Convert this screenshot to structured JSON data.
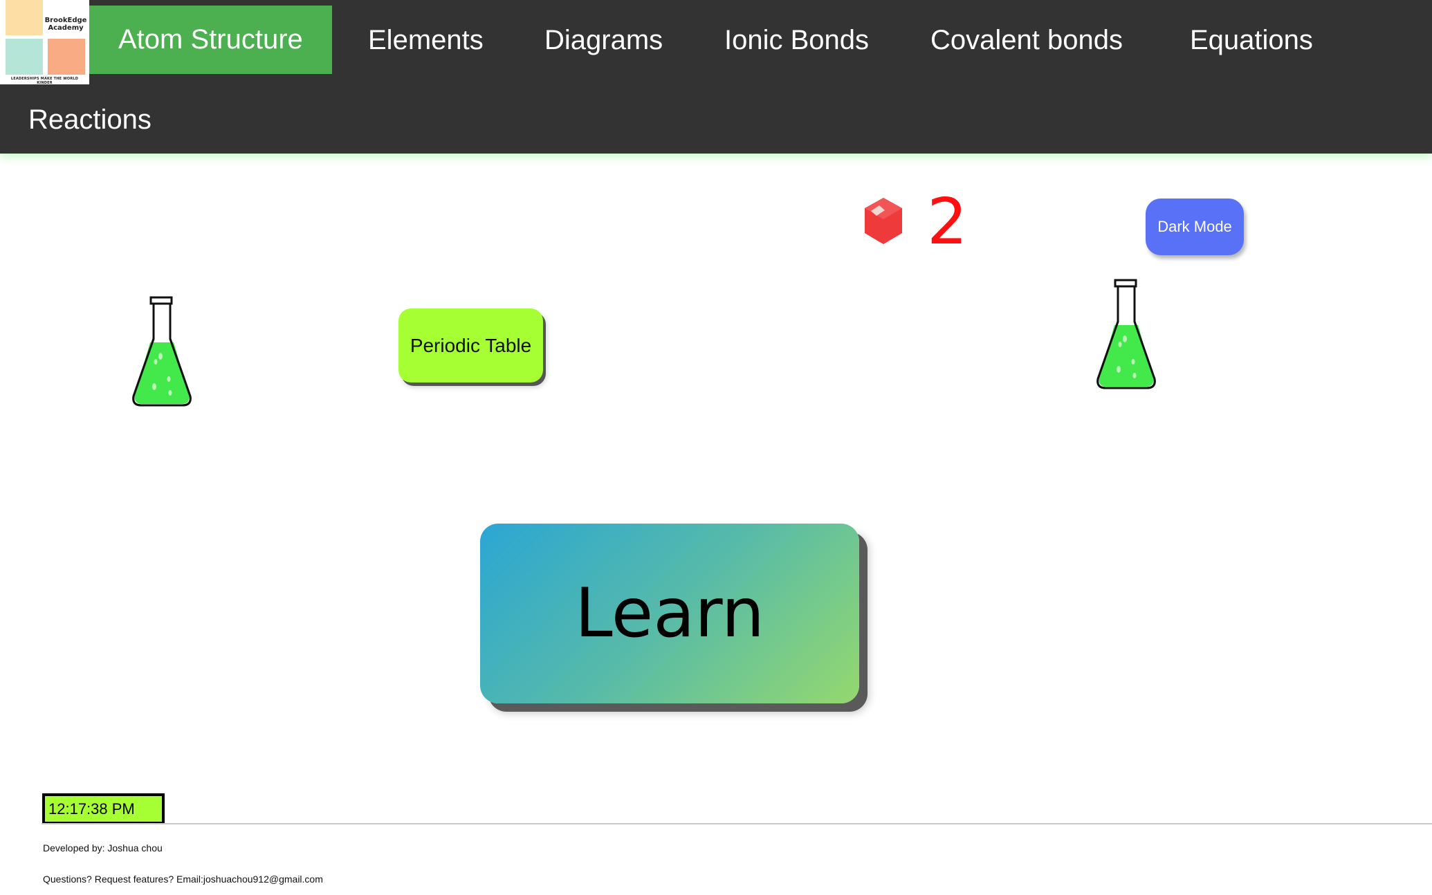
{
  "brand": {
    "name_line1": "BrookEdge",
    "name_line2": "Academy",
    "tagline": "LEADERSHIPS MAKE THE WORLD KINDER"
  },
  "nav": {
    "items": [
      {
        "label": "Atom Structure",
        "active": true
      },
      {
        "label": "Elements"
      },
      {
        "label": "Diagrams"
      },
      {
        "label": "Ionic Bonds"
      },
      {
        "label": "Covalent bonds"
      },
      {
        "label": "Equations"
      },
      {
        "label": "Reactions"
      }
    ]
  },
  "score": {
    "value": "2",
    "icon": "red-gem-icon",
    "color": "#ff1010"
  },
  "buttons": {
    "dark_mode": "Dark Mode",
    "periodic_table": "Periodic Table",
    "learn": "Learn"
  },
  "icons": {
    "flask_left": "flask-icon",
    "flask_right": "flask-icon"
  },
  "colors": {
    "nav_bg": "#333333",
    "nav_active": "#4caf50",
    "lime": "#a6ff33",
    "dark_mode_btn": "#5971f7"
  },
  "clock": {
    "time": "12:17:38 PM"
  },
  "footer": {
    "developer": "Developed by: Joshua chou",
    "contact": "Questions? Request features? Email:joshuachou912@gmail.com"
  }
}
